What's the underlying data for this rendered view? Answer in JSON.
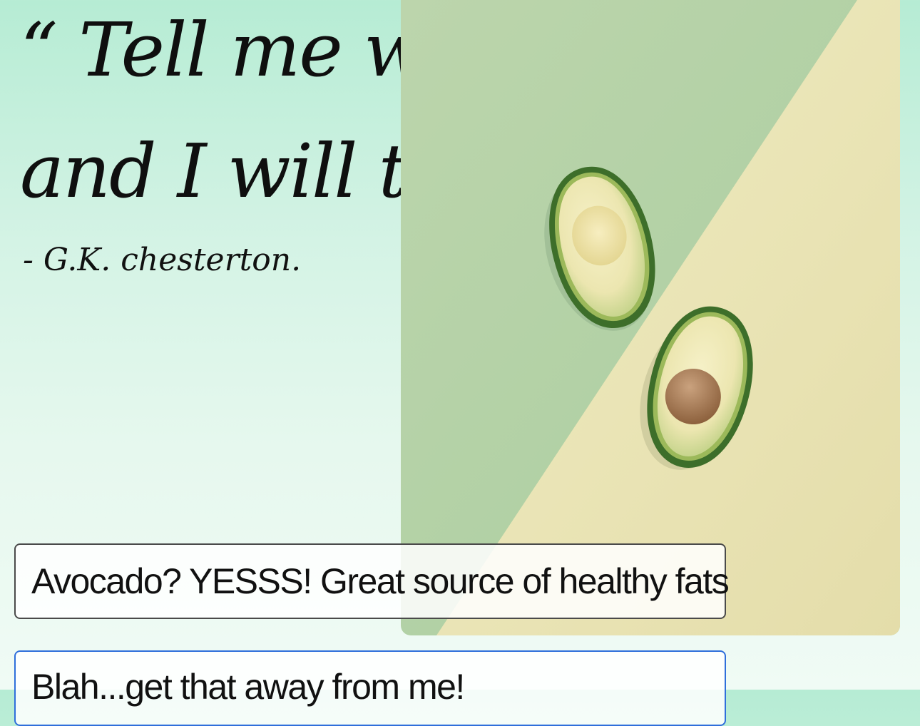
{
  "quote": {
    "line1": "“ Tell me what",
    "line2": "and I will tell",
    "author": "- G.K. chesterton."
  },
  "image": {
    "icon": "avocado-photo",
    "colors": {
      "green": "#b9d6a8",
      "yellow": "#ebe7ba"
    }
  },
  "options": [
    {
      "text": "Avocado? YESSS! Great source of healthy fats"
    },
    {
      "text": "Blah...get that away from me!"
    }
  ],
  "colors": {
    "selected_border": "#2f6fdb",
    "default_border": "#4a4a4a"
  }
}
